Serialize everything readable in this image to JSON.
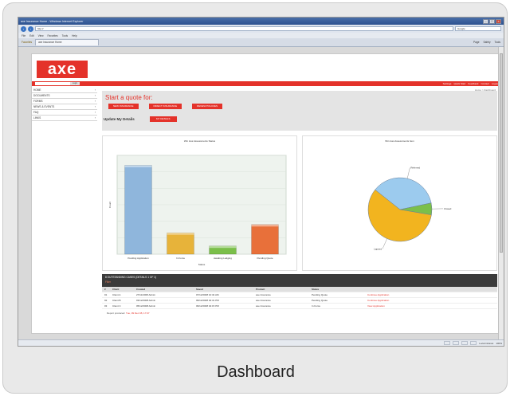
{
  "window": {
    "title": "axe Insurance Home - Windows Internet Explorer",
    "address": "http://",
    "search_placeholder": "Google"
  },
  "menu": [
    "File",
    "Edit",
    "View",
    "Favorites",
    "Tools",
    "Help"
  ],
  "favorites_label": "Favorites",
  "tab_label": "axe Insurance Home",
  "tools": [
    "Page",
    "Safety",
    "Tools"
  ],
  "site": {
    "logo": "axe",
    "go_label": "Login",
    "toplinks": [
      "Settings",
      "Quick Start",
      "Feedback",
      "Contact",
      "Logout"
    ],
    "breadcrumb": "Home > Dashboard"
  },
  "sidebar": [
    "HOME",
    "DOCUMENTS",
    "FORMS",
    "NEWS & EVENTS",
    "FAQ",
    "LINKS"
  ],
  "quote": {
    "title": "Start a quote for:",
    "buttons": [
      "NEW INSURANCE",
      "DIRECT INSURANCE",
      "RENEW POLICIES"
    ],
    "update_label": "Update My Details",
    "update_button": "MY DETAILS"
  },
  "bar_chart": {
    "title": "Win loss Assessments Status",
    "xlabel": "Status",
    "ylabel": "Count",
    "categories": [
      "Pending Application",
      "In Force",
      "Awaiting Lodging",
      "Pending Quote"
    ],
    "values": [
      54,
      13,
      5,
      18
    ],
    "ymax": 60,
    "colors": [
      "#8fb6dc",
      "#e7b33a",
      "#7bbf4a",
      "#e8703a"
    ]
  },
  "pie_chart": {
    "title": "Win loss Assessments Item",
    "slices": [
      {
        "label": "Referred",
        "value": 36,
        "color": "#9ccbee"
      },
      {
        "label": "Closed",
        "value": 6,
        "color": "#7bbf4a"
      },
      {
        "label": "Lapsed",
        "value": 58,
        "color": "#f2b41f"
      }
    ]
  },
  "table": {
    "title": "8 OUTSTANDING CASES (DETAILS 1 OF 1)",
    "subtitle": "Filter",
    "headers": [
      "#",
      "Client",
      "Created",
      "Saved",
      "Product",
      "Status",
      ""
    ],
    "rows": [
      [
        "01",
        "Client A",
        "27/11/2008 Admin",
        "07/12/2008 10:34 AM",
        "axe Insurance",
        "Pending Quote",
        "Continue Application"
      ],
      [
        "02",
        "Client B",
        "03/12/2008 Admin",
        "09/12/2008 02:31 PM",
        "axe Insurance",
        "Pending Quote",
        "Continue Application"
      ],
      [
        "03",
        "Client C",
        "05/12/2008 Admin",
        "09/12/2008 04:15 PM",
        "axe Insurance",
        "In Force",
        "View Application"
      ]
    ],
    "footer_label": "Report produced:",
    "footer_value": "Tue, 09 Dec 08, 17:07"
  },
  "status": {
    "zone": "Local intranet",
    "zoom": "100%"
  },
  "caption": "Dashboard"
}
